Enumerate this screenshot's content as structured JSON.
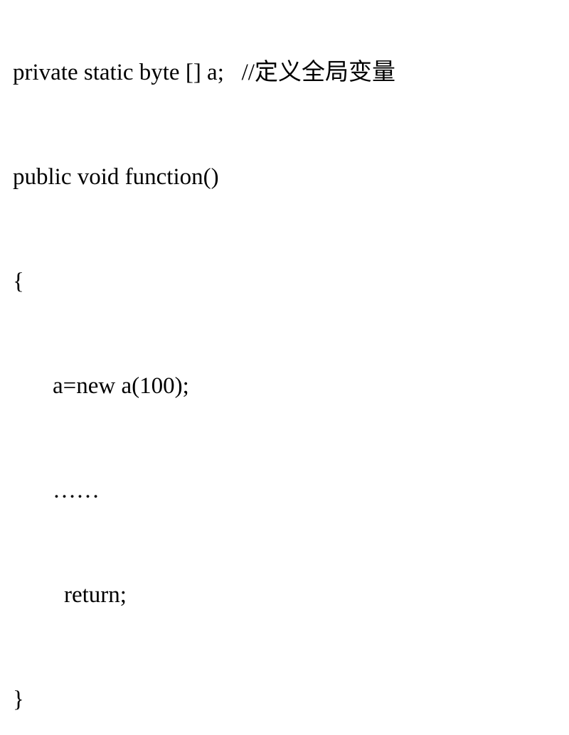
{
  "code": {
    "line1_code": "private static byte [] a;",
    "line1_spacer": "   ",
    "line1_comment": "//定义全局变量",
    "line2": "public void function()",
    "line3": "{",
    "line4": "a=new a(100);",
    "line5": "……",
    "line6": "return;",
    "line7": "}"
  }
}
